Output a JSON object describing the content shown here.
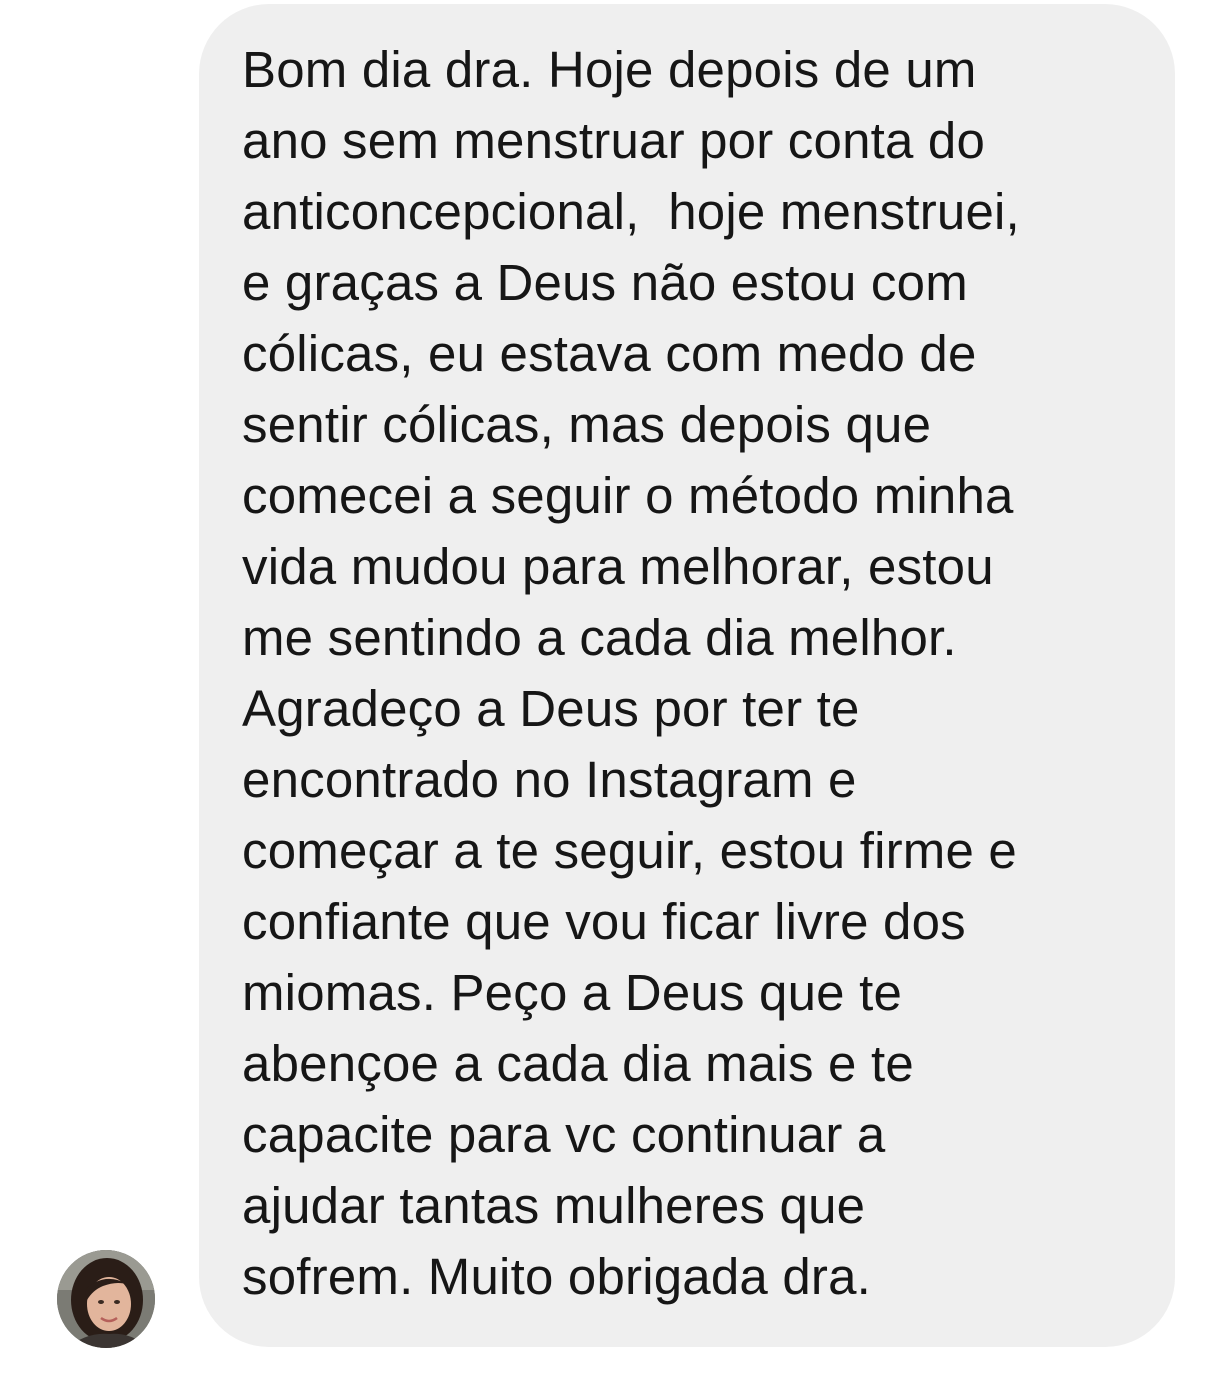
{
  "message": {
    "lines": [
      "Bom dia dra. Hoje depois de um",
      "ano sem menstruar por conta do",
      "anticoncepcional,  hoje menstruei,",
      "e graças a Deus não estou com",
      "cólicas, eu estava com medo de",
      "sentir cólicas, mas depois que",
      "comecei a seguir o método minha",
      "vida mudou para melhorar, estou",
      "me sentindo a cada dia melhor.",
      "Agradeço a Deus por ter te",
      "encontrado no Instagram e",
      "começar a te seguir, estou firme e",
      "confiante que vou ficar livre dos",
      "miomas. Peço a Deus que te",
      "abençoe a cada dia mais e te",
      "capacite para vc continuar a",
      "ajudar tantas mulheres que",
      "sofrem. Muito obrigada dra."
    ]
  },
  "colors": {
    "bubble_background": "#efefef",
    "text": "#161616",
    "page_background": "#ffffff"
  },
  "sender": {
    "avatar_icon": "profile-photo"
  }
}
